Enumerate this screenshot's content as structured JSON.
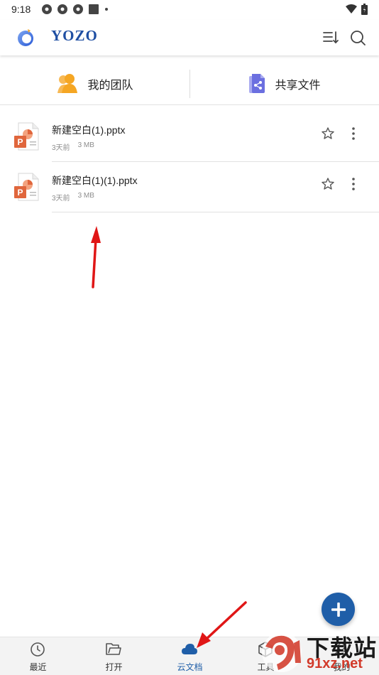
{
  "status_bar": {
    "time": "9:18"
  },
  "header": {
    "app_title": "YOZO"
  },
  "team_row": {
    "my_team_label": "我的团队",
    "shared_files_label": "共享文件"
  },
  "files": [
    {
      "name": "新建空白(1).pptx",
      "age": "3天前",
      "size": "3 MB"
    },
    {
      "name": "新建空白(1)(1).pptx",
      "age": "3天前",
      "size": "3 MB"
    }
  ],
  "bottom_nav": {
    "items": [
      {
        "label": "最近",
        "icon": "clock-icon"
      },
      {
        "label": "打开",
        "icon": "folder-open-icon"
      },
      {
        "label": "云文档",
        "icon": "cloud-icon"
      },
      {
        "label": "工具",
        "icon": "toolbox-icon"
      },
      {
        "label": "我的",
        "icon": "person-icon"
      }
    ],
    "active_index": 2
  },
  "colors": {
    "brand_blue": "#1f5ea8",
    "team_orange": "#f5a623",
    "share_purple": "#6b6fe0",
    "ppt_orange": "#e0663c",
    "annotation_red": "#e01616"
  },
  "watermark": {
    "line1": "下载站",
    "line2": "91xz.net"
  }
}
